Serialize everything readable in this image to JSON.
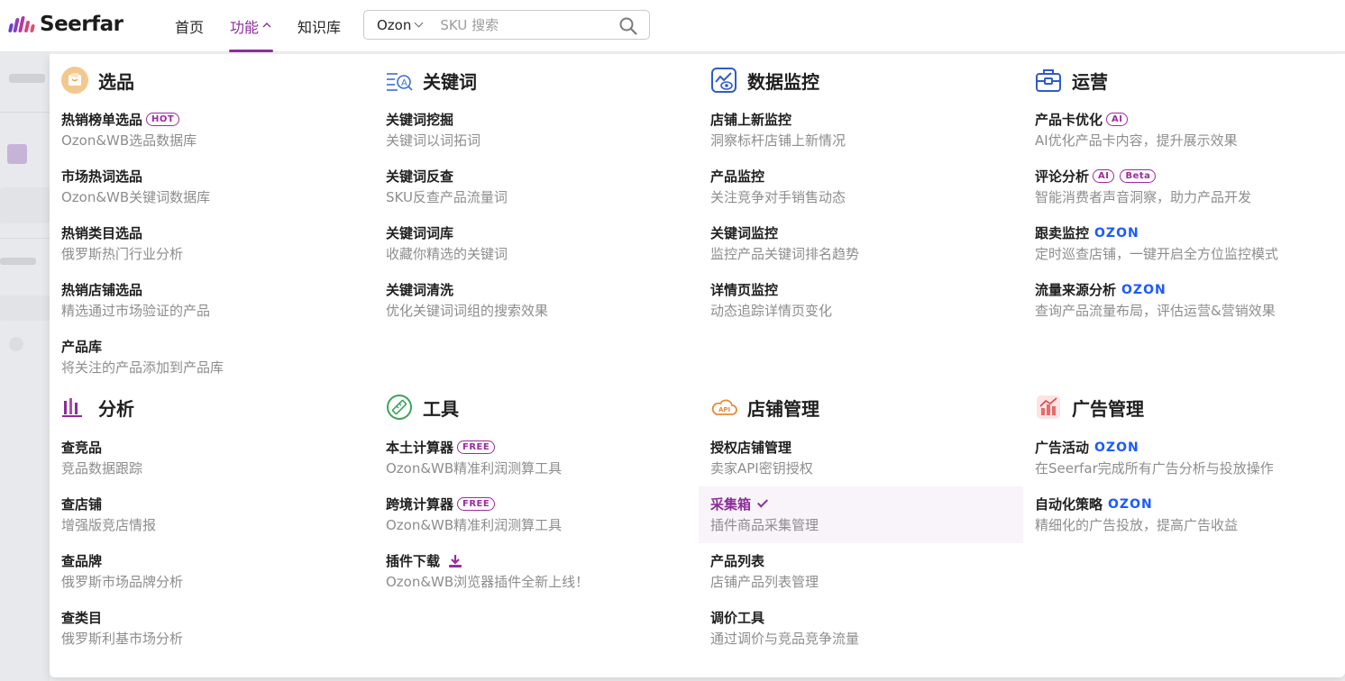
{
  "brand": {
    "name": "Seerfar",
    "colors": [
      "#6a3fd4",
      "#8a3fbf",
      "#b13aa0",
      "#d2467e",
      "#e0506a"
    ]
  },
  "nav": {
    "home": "首页",
    "features": "功能",
    "features_arrow": "^",
    "knowledge": "知识库",
    "active_color": "#8a2e98"
  },
  "search": {
    "platform": "Ozon",
    "placeholder": "SKU 搜索",
    "icon": "search-icon"
  },
  "sections": {
    "selection": {
      "title": "选品",
      "icon": "product-box-icon",
      "items": [
        {
          "label": "热销榜单选品",
          "badge": "HOT",
          "desc": "Ozon&WB选品数据库"
        },
        {
          "label": "市场热词选品",
          "desc": "Ozon&WB关键词数据库"
        },
        {
          "label": "热销类目选品",
          "desc": "俄罗斯热门行业分析"
        },
        {
          "label": "热销店铺选品",
          "desc": "精选通过市场验证的产品"
        },
        {
          "label": "产品库",
          "desc": "将关注的产品添加到产品库"
        }
      ]
    },
    "keywords": {
      "title": "关键词",
      "icon": "keyword-search-icon",
      "items": [
        {
          "label": "关键词挖掘",
          "desc": "关键词以词拓词"
        },
        {
          "label": "关键词反查",
          "desc": "SKU反查产品流量词"
        },
        {
          "label": "关键词词库",
          "desc": "收藏你精选的关键词"
        },
        {
          "label": "关键词清洗",
          "desc": "优化关键词词组的搜索效果"
        }
      ]
    },
    "monitoring": {
      "title": "数据监控",
      "icon": "monitor-eye-icon",
      "items": [
        {
          "label": "店铺上新监控",
          "desc": "洞察标杆店铺上新情况"
        },
        {
          "label": "产品监控",
          "desc": "关注竞争对手销售动态"
        },
        {
          "label": "关键词监控",
          "desc": "监控产品关键词排名趋势"
        },
        {
          "label": "详情页监控",
          "desc": "动态追踪详情页变化"
        }
      ]
    },
    "operations": {
      "title": "运营",
      "icon": "toolbox-icon",
      "items": [
        {
          "label": "产品卡优化",
          "badge": "AI",
          "desc": "AI优化产品卡内容，提升展示效果"
        },
        {
          "label": "评论分析",
          "badge": "AI",
          "badge2": "Beta",
          "desc": "智能消费者声音洞察，助力产品开发"
        },
        {
          "label": "跟卖监控",
          "ozon": "OZON",
          "desc": "定时巡查店铺，一键开启全方位监控模式"
        },
        {
          "label": "流量来源分析",
          "ozon": "OZON",
          "desc": "查询产品流量布局，评估运营&营销效果"
        }
      ]
    },
    "analysis": {
      "title": "分析",
      "icon": "bar-chart-icon",
      "items": [
        {
          "label": "查竞品",
          "desc": "竞品数据跟踪"
        },
        {
          "label": "查店铺",
          "desc": "增强版竞店情报"
        },
        {
          "label": "查品牌",
          "desc": "俄罗斯市场品牌分析"
        },
        {
          "label": "查类目",
          "desc": "俄罗斯利基市场分析"
        }
      ]
    },
    "tools": {
      "title": "工具",
      "icon": "ruler-icon",
      "items": [
        {
          "label": "本土计算器",
          "badge": "FREE",
          "desc": "Ozon&WB精准利润测算工具"
        },
        {
          "label": "跨境计算器",
          "badge": "FREE",
          "desc": "Ozon&WB精准利润测算工具"
        },
        {
          "label": "插件下载",
          "desc": "Ozon&WB浏览器插件全新上线！"
        }
      ]
    },
    "store": {
      "title": "店铺管理",
      "icon": "api-cloud-icon",
      "items": [
        {
          "label": "授权店铺管理",
          "desc": "卖家API密钥授权"
        },
        {
          "label": "采集箱",
          "desc": "插件商品采集管理"
        },
        {
          "label": "产品列表",
          "desc": "店铺产品列表管理"
        },
        {
          "label": "调价工具",
          "desc": "通过调价与竞品竞争流量"
        }
      ]
    },
    "ads": {
      "title": "广告管理",
      "icon": "ad-chart-icon",
      "items": [
        {
          "label": "广告活动",
          "ozon": "OZON",
          "desc": "在Seerfar完成所有广告分析与投放操作"
        },
        {
          "label": "自动化策略",
          "ozon": "OZON",
          "desc": "精细化的广告投放，提高广告收益"
        }
      ]
    }
  }
}
